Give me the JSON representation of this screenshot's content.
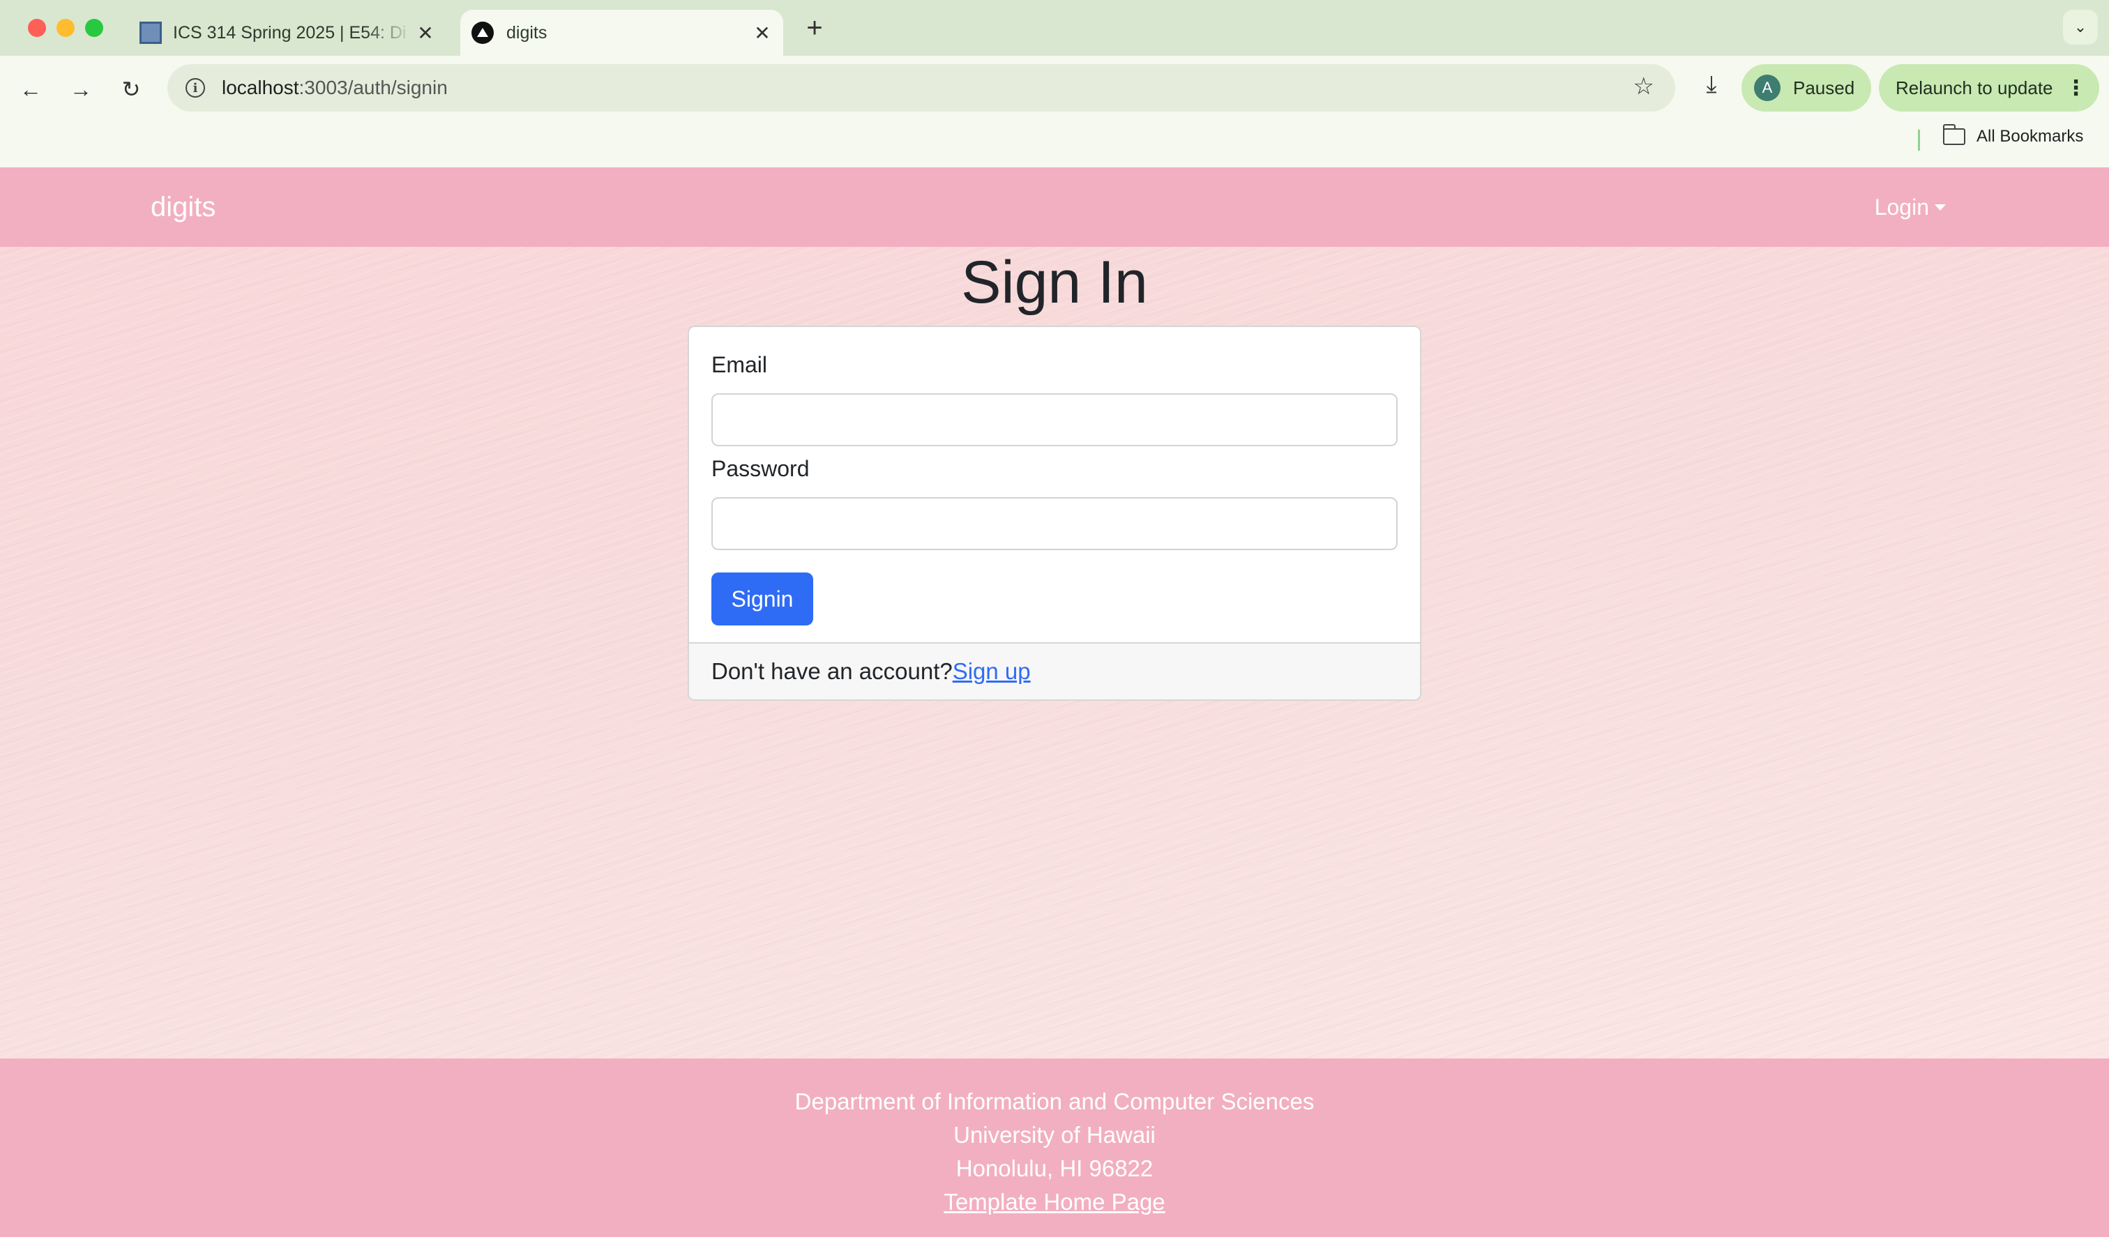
{
  "browser": {
    "tabs": [
      {
        "title": "ICS 314 Spring 2025 | E54: Di",
        "active": false
      },
      {
        "title": "digits",
        "active": true
      }
    ],
    "url": {
      "host": "localhost",
      "rest": ":3003/auth/signin"
    },
    "profile": {
      "initial": "A",
      "status": "Paused"
    },
    "relaunch_label": "Relaunch to update",
    "bookmarks_label": "All Bookmarks",
    "colors": {
      "tabstrip": "#d9e7d0",
      "toolbar": "#f6f9f0",
      "chip": "#c8e9b2"
    }
  },
  "navbar": {
    "brand": "digits",
    "login_label": "Login",
    "color": "#f2afc2"
  },
  "signin": {
    "title": "Sign In",
    "email_label": "Email",
    "email_value": "",
    "password_label": "Password",
    "password_value": "",
    "submit_label": "Signin",
    "footer_text": "Don't have an account?",
    "signup_link": "Sign up",
    "button_color": "#2f6cf5"
  },
  "footer": {
    "line1": "Department of Information and Computer Sciences",
    "line2": "University of Hawaii",
    "line3": "Honolulu, HI 96822",
    "link": "Template Home Page"
  }
}
